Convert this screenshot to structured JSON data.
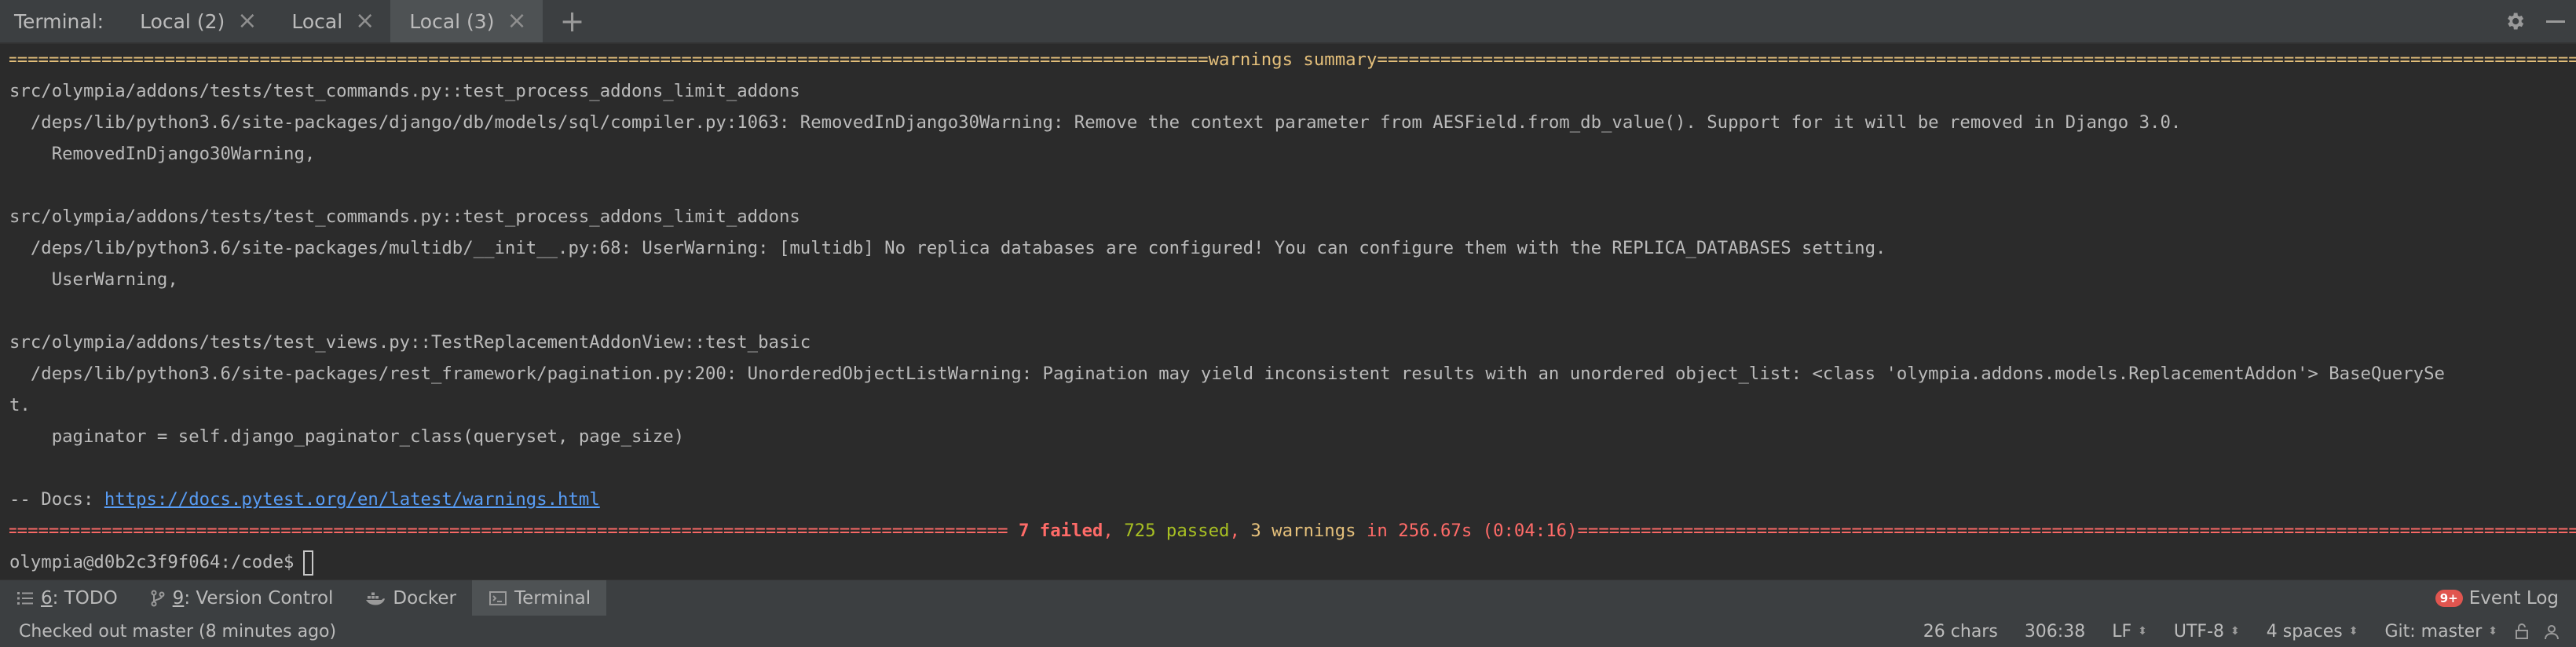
{
  "tabbar": {
    "tool_title": "Terminal:",
    "tabs": [
      {
        "label": "Local (2)",
        "active": false
      },
      {
        "label": "Local",
        "active": false
      },
      {
        "label": "Local (3)",
        "active": true
      }
    ],
    "add_tab_glyph": "+",
    "close_glyph": "×"
  },
  "terminal": {
    "summary_title": " warnings summary ",
    "lines": [
      "src/olympia/addons/tests/test_commands.py::test_process_addons_limit_addons",
      "  /deps/lib/python3.6/site-packages/django/db/models/sql/compiler.py:1063: RemovedInDjango30Warning: Remove the context parameter from AESField.from_db_value(). Support for it will be removed in Django 3.0.",
      "    RemovedInDjango30Warning,",
      "",
      "src/olympia/addons/tests/test_commands.py::test_process_addons_limit_addons",
      "  /deps/lib/python3.6/site-packages/multidb/__init__.py:68: UserWarning: [multidb] No replica databases are configured! You can configure them with the REPLICA_DATABASES setting.",
      "    UserWarning,",
      "",
      "src/olympia/addons/tests/test_views.py::TestReplacementAddonView::test_basic",
      "  /deps/lib/python3.6/site-packages/rest_framework/pagination.py:200: UnorderedObjectListWarning: Pagination may yield inconsistent results with an unordered object_list: <class 'olympia.addons.models.ReplacementAddon'> BaseQuerySe",
      "t.",
      "    paginator = self.django_paginator_class(queryset, page_size)",
      ""
    ],
    "docs_prefix": "-- Docs: ",
    "docs_link": "https://docs.pytest.org/en/latest/warnings.html",
    "result": {
      "failed": "7 failed",
      "comma1": ", ",
      "passed": "725 passed",
      "comma2": ", ",
      "warnings": "3 warnings",
      "duration": " in 256.67s (0:04:16) "
    },
    "prompt": "olympia@d0b2c3f9f064:/code$"
  },
  "bottom_tools": [
    {
      "key": "6",
      "label": ": TODO",
      "icon": "todo-list-icon"
    },
    {
      "key": "9",
      "label": ": Version Control",
      "icon": "branch-icon"
    },
    {
      "key": "",
      "label": "Docker",
      "icon": "docker-icon"
    },
    {
      "key": "",
      "label": "Terminal",
      "icon": "terminal-icon",
      "active": true
    }
  ],
  "event_log": {
    "badge": "9+",
    "label": "Event Log"
  },
  "status": {
    "message": "Checked out master (8 minutes ago)",
    "chars": "26 chars",
    "position": "306:38",
    "line_sep": "LF",
    "encoding": "UTF-8",
    "indent": "4 spaces",
    "vcs": "Git: master"
  },
  "colors": {
    "background": "#2b2b2b",
    "panel": "#3c3f41",
    "failed": "#ff6b68",
    "passed": "#a8c023",
    "warnings": "#e5c07b",
    "link": "#589df6"
  }
}
